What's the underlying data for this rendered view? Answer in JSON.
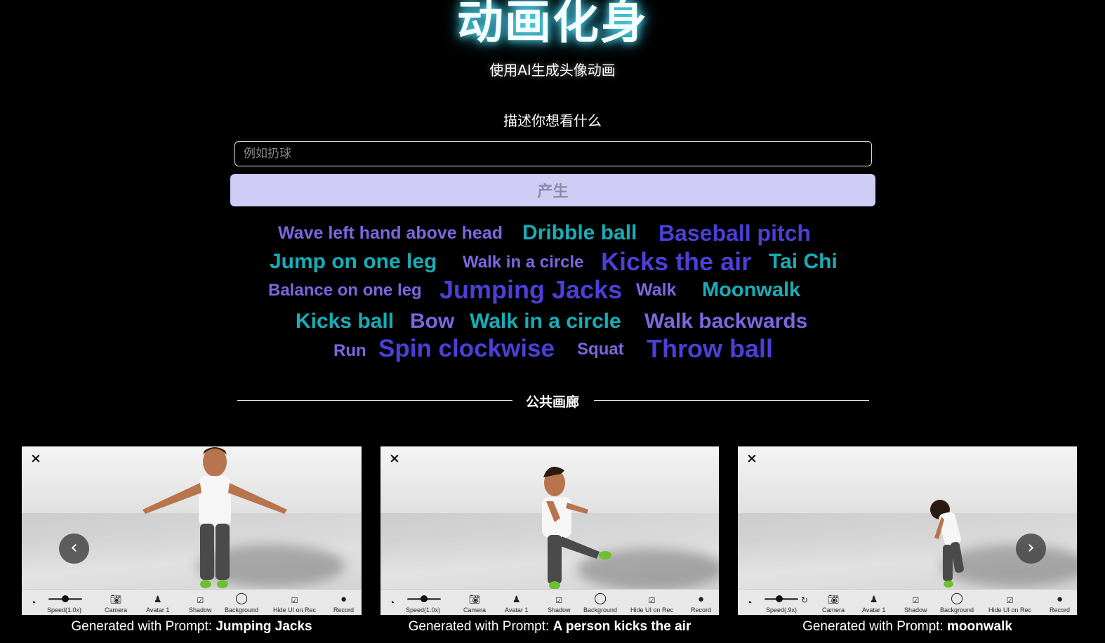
{
  "header": {
    "title": "动画化身",
    "subtitle": "使用AI生成头像动画"
  },
  "prompt": {
    "label": "描述你想看什么",
    "placeholder": "例如扔球",
    "value": "",
    "generate_label": "产生"
  },
  "tags": [
    {
      "text": "Wave left hand above head",
      "color": "lavender"
    },
    {
      "text": "Dribble ball",
      "color": "teal"
    },
    {
      "text": "Baseball pitch",
      "color": "indigo"
    },
    {
      "text": "Jump on one leg",
      "color": "teal"
    },
    {
      "text": "Walk in a circle",
      "color": "lavender"
    },
    {
      "text": "Kicks the air",
      "color": "indigo"
    },
    {
      "text": "Tai Chi",
      "color": "teal"
    },
    {
      "text": "Balance on one leg",
      "color": "lavender"
    },
    {
      "text": "Jumping Jacks",
      "color": "indigo"
    },
    {
      "text": "Walk",
      "color": "lavender"
    },
    {
      "text": "Moonwalk",
      "color": "teal"
    },
    {
      "text": "Kicks ball",
      "color": "teal"
    },
    {
      "text": "Bow",
      "color": "lavender"
    },
    {
      "text": "Walk in a circle",
      "color": "teal"
    },
    {
      "text": "Walk backwards",
      "color": "lavender"
    },
    {
      "text": "Run",
      "color": "lavender"
    },
    {
      "text": "Spin clockwise",
      "color": "indigo"
    },
    {
      "text": "Squat",
      "color": "lavender"
    },
    {
      "text": "Throw ball",
      "color": "indigo"
    }
  ],
  "gallery": {
    "title": "公共画廊",
    "caption_prefix": "Generated with Prompt: ",
    "cards": [
      {
        "close_glyph": "×",
        "speed_label": "Speed(1.0x)",
        "speed_fraction": 0.4,
        "toolbar": [
          "Camera",
          "Avatar 1",
          "Shadow",
          "Background",
          "Hide UI on Rec",
          "Record"
        ],
        "prompt": "Jumping Jacks"
      },
      {
        "close_glyph": "×",
        "speed_label": "Speed(1.0x)",
        "speed_fraction": 0.4,
        "toolbar": [
          "Camera",
          "Avatar 1",
          "Shadow",
          "Background",
          "Hide UI on Rec",
          "Record"
        ],
        "prompt": "A person kicks the air"
      },
      {
        "close_glyph": "×",
        "speed_label": "Speed(.9x)",
        "speed_fraction": 0.35,
        "toolbar": [
          "Camera",
          "Avatar 1",
          "Shadow",
          "Background",
          "Hide UI on Rec",
          "Record"
        ],
        "prompt": "moonwalk"
      }
    ],
    "prev_glyph": "‹",
    "next_glyph": "›"
  },
  "colors": {
    "lavender": "#7c66e0",
    "teal": "#17adb8",
    "indigo": "#4b3fd6",
    "title_glow": "#5fe6ff",
    "button_bg": "#cfccf5"
  }
}
